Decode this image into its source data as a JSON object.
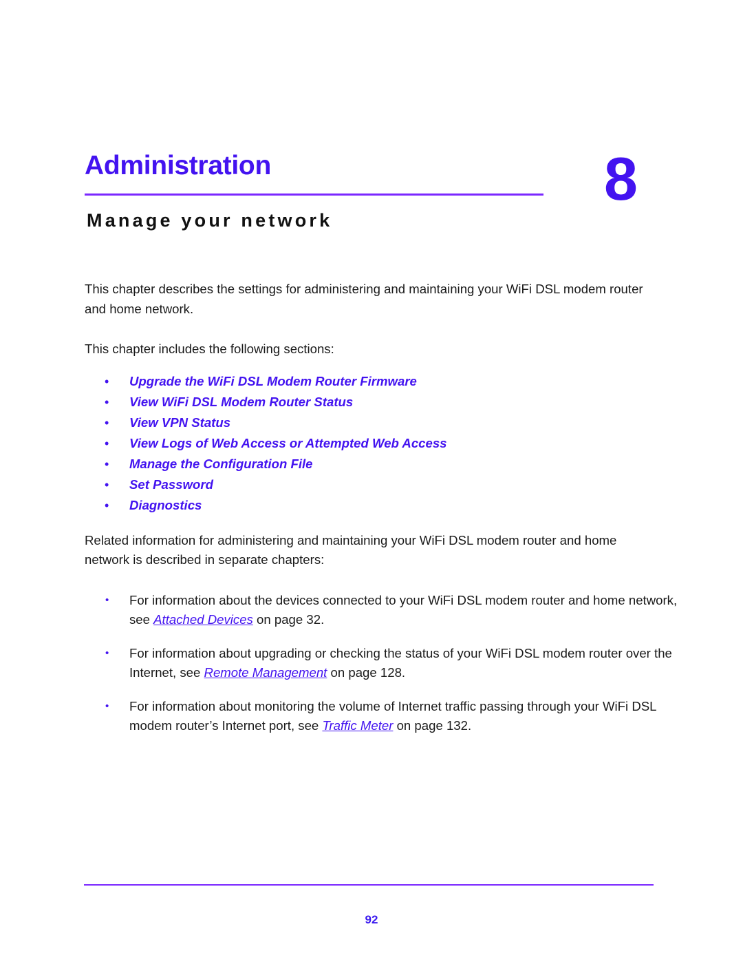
{
  "chapter": {
    "title": "Administration",
    "subtitle": "Manage your network",
    "number": "8"
  },
  "body": {
    "intro_paragraph": "This chapter describes the settings for administering and maintaining your WiFi DSL modem router and home network.",
    "sections_lead": "This chapter includes the following sections:",
    "related_lead": "Related information for administering and maintaining your WiFi DSL modem router and home network is described in separate chapters:"
  },
  "bullet_glyph": "•",
  "section_links": [
    {
      "label": "Upgrade the WiFi DSL Modem Router Firmware"
    },
    {
      "label": "View WiFi DSL Modem Router Status"
    },
    {
      "label": "View VPN Status"
    },
    {
      "label": "View Logs of Web Access or Attempted Web Access"
    },
    {
      "label": "Manage the Configuration File"
    },
    {
      "label": "Set Password"
    },
    {
      "label": "Diagnostics"
    }
  ],
  "related_items": [
    {
      "before": "For information about the devices connected to your WiFi DSL modem router and home network, see ",
      "link": "Attached Devices",
      "after": " on page 32."
    },
    {
      "before": "For information about upgrading or checking the status of your WiFi DSL modem router over the Internet, see ",
      "link": "Remote Management",
      "after": " on page 128."
    },
    {
      "before": "For information about monitoring the volume of Internet traffic passing through your WiFi DSL modem router’s Internet port, see ",
      "link": "Traffic Meter",
      "after": " on page 132."
    }
  ],
  "footer": {
    "page_number": "92"
  },
  "colors": {
    "accent_purple": "#4313f0",
    "rule_purple": "#7b28ff",
    "body_text": "#1a1a1a"
  }
}
